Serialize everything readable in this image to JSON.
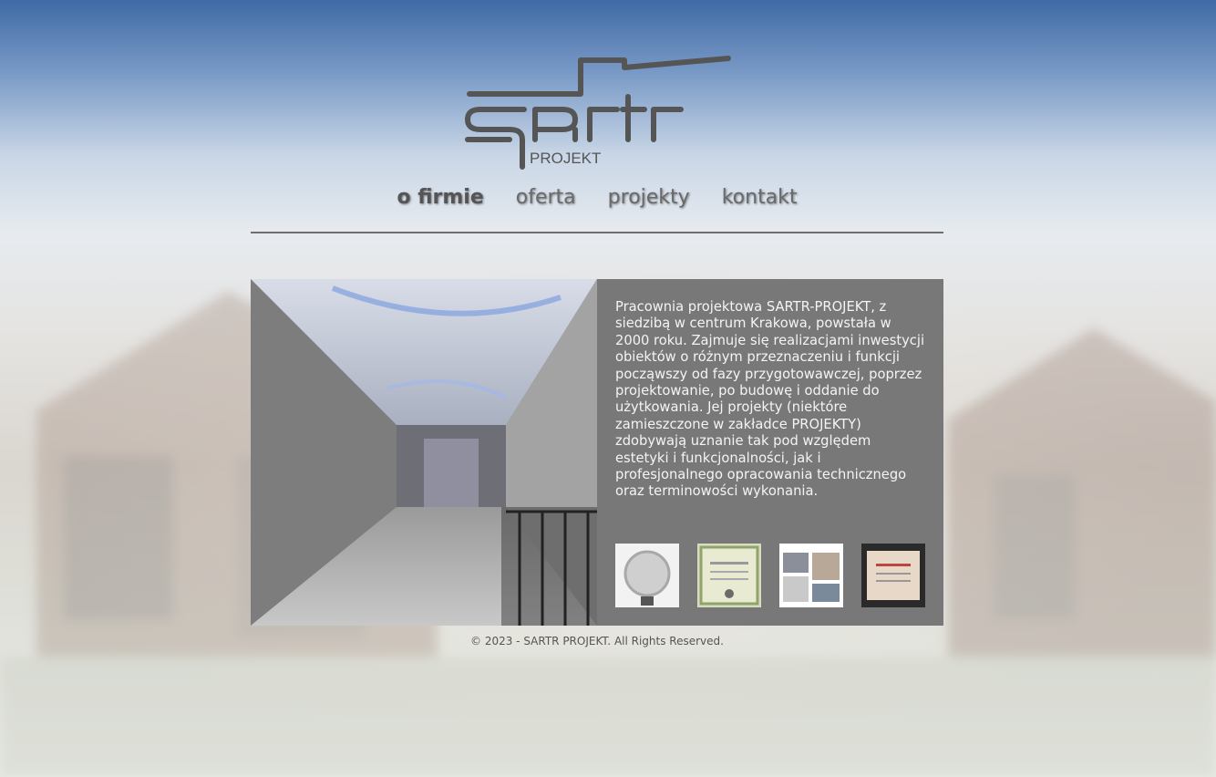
{
  "logo": {
    "main": "sartr",
    "sub": "PROJEKT"
  },
  "nav": {
    "items": [
      "o firmie",
      "oferta",
      "projekty",
      "kontakt"
    ],
    "active": "o firmie"
  },
  "intro": {
    "text": "Pracownia projektowa SARTR-PROJEKT, z siedzibą w centrum Krakowa, powstała w 2000 roku. Zajmuje się realizacjami inwestycji obiektów o różnym przeznaczeniu i funkcji począwszy od fazy przygotowawczej, poprzez projektowanie, po budowę i oddanie do użytkowania. Jej projekty (niektóre zamieszczone w zakładce PROJEKTY) zdobywają uznanie tak pod względem estetyki i funkcjonalności, jak i profesjonalnego opracowania technicznego oraz terminowości wykonania."
  },
  "awards": [
    "medal",
    "diploma-green",
    "publication",
    "diploma-framed"
  ],
  "footer": {
    "text": "© 2023 - SARTR PROJEKT. All Rights Reserved."
  }
}
